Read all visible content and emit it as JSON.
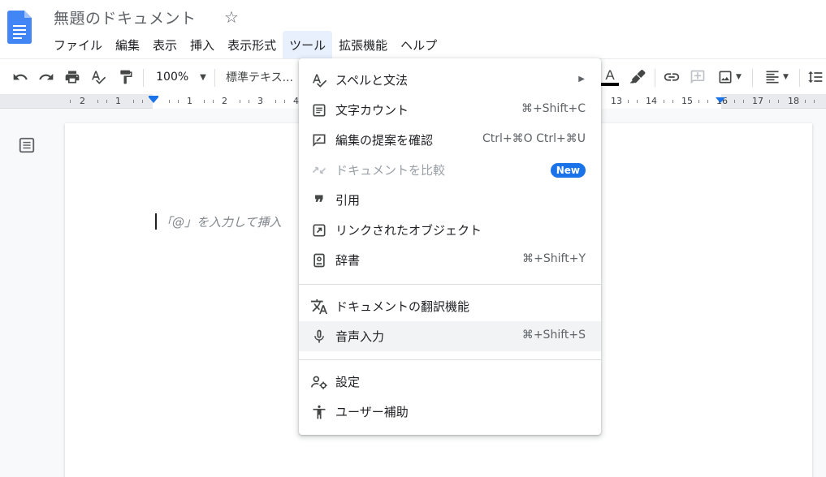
{
  "app": {
    "title": "無題のドキュメント",
    "logo_icon": "google-docs-icon",
    "star_icon": "star-outline-icon"
  },
  "menubar": [
    "ファイル",
    "編集",
    "表示",
    "挿入",
    "表示形式",
    "ツール",
    "拡張機能",
    "ヘルプ"
  ],
  "menubar_active": "ツール",
  "toolbar": {
    "zoom": "100%",
    "style": "標準テキス...",
    "icons": [
      "undo-icon",
      "redo-icon",
      "print-icon",
      "spellcheck-icon",
      "paint-format-icon",
      "text-color-icon",
      "highlight-icon",
      "link-icon",
      "add-comment-icon",
      "insert-image-icon",
      "align-icon",
      "line-spacing-icon"
    ]
  },
  "ruler": {
    "labels_left": [
      "2",
      "1"
    ],
    "labels_right": [
      "1",
      "2",
      "3",
      "4",
      "13",
      "14",
      "15",
      "16",
      "17",
      "18"
    ]
  },
  "document": {
    "placeholder": "「@」を入力して挿入"
  },
  "tools_menu": {
    "items": [
      {
        "icon": "spelling-grammar-icon",
        "label": "スペルと文法",
        "submenu": true
      },
      {
        "icon": "word-count-icon",
        "label": "文字カウント",
        "shortcut": "⌘+Shift+C"
      },
      {
        "icon": "review-edits-icon",
        "label": "編集の提案を確認",
        "shortcut": "Ctrl+⌘O Ctrl+⌘U"
      },
      {
        "icon": "compare-documents-icon",
        "label": "ドキュメントを比較",
        "badge": "New",
        "disabled": true
      },
      {
        "icon": "citation-quote-icon",
        "label": "引用"
      },
      {
        "icon": "linked-objects-icon",
        "label": "リンクされたオブジェクト"
      },
      {
        "icon": "dictionary-icon",
        "label": "辞書",
        "shortcut": "⌘+Shift+Y"
      },
      {
        "icon": "translate-icon",
        "label": "ドキュメントの翻訳機能"
      },
      {
        "icon": "microphone-icon",
        "label": "音声入力",
        "shortcut": "⌘+Shift+S",
        "highlighted": true
      },
      {
        "icon": "settings-person-icon",
        "label": "設定"
      },
      {
        "icon": "accessibility-icon",
        "label": "ユーザー補助"
      }
    ]
  },
  "colors": {
    "accent": "#1a73e8",
    "active_menu_bg": "#e8f0fe",
    "hover_bg": "#f1f3f4",
    "docs_blue": "#4285f4"
  }
}
